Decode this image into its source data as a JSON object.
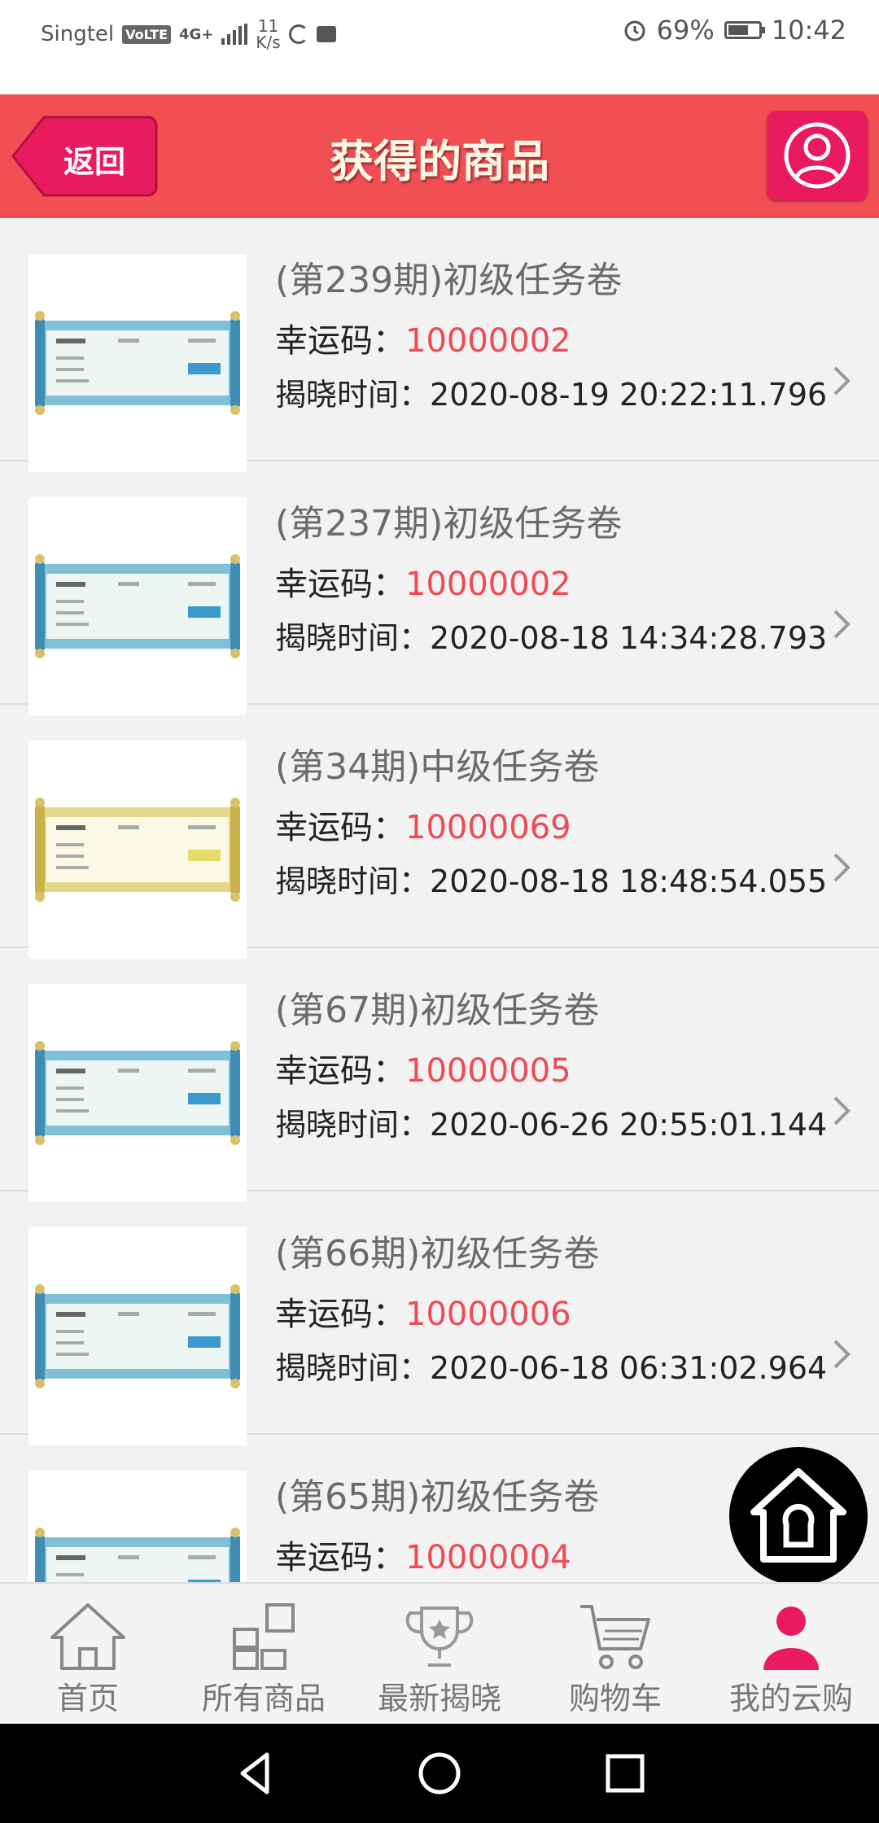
{
  "status_bar": {
    "carrier": "Singtel",
    "volte": "VoLTE",
    "network": "4G+",
    "speed_value": "11",
    "speed_unit": "K/s",
    "battery": "69%",
    "time": "10:42"
  },
  "header": {
    "back_label": "返回",
    "title": "获得的商品",
    "user_icon": "user-circle-icon"
  },
  "labels": {
    "lucky_code": "幸运码：",
    "reveal_time": "揭晓时间："
  },
  "items": [
    {
      "title": "(第239期)初级任务卷",
      "code": "10000002",
      "time": "2020-08-19 20:22:11.796",
      "scroll": "blue",
      "thumb_title": "初级卷轴",
      "thumb_btn": "兑换"
    },
    {
      "title": "(第237期)初级任务卷",
      "code": "10000002",
      "time": "2020-08-18 14:34:28.793",
      "scroll": "blue",
      "thumb_title": "初级卷轴",
      "thumb_btn": "兑换"
    },
    {
      "title": "(第34期)中级任务卷",
      "code": "10000069",
      "time": "2020-08-18 18:48:54.055",
      "scroll": "gold",
      "thumb_title": "中级卷轴",
      "thumb_btn": "兑换"
    },
    {
      "title": "(第67期)初级任务卷",
      "code": "10000005",
      "time": "2020-06-26 20:55:01.144",
      "scroll": "blue",
      "thumb_title": "初级卷轴",
      "thumb_btn": "兑换"
    },
    {
      "title": "(第66期)初级任务卷",
      "code": "10000006",
      "time": "2020-06-18 06:31:02.964",
      "scroll": "blue",
      "thumb_title": "初级卷轴",
      "thumb_btn": "兑换"
    },
    {
      "title": "(第65期)初级任务卷",
      "code": "10000004",
      "time": "",
      "scroll": "blue",
      "thumb_title": "初级卷轴",
      "thumb_btn": "兑换"
    }
  ],
  "tabs": [
    {
      "label": "首页",
      "icon": "home-icon"
    },
    {
      "label": "所有商品",
      "icon": "grid-icon"
    },
    {
      "label": "最新揭晓",
      "icon": "trophy-icon"
    },
    {
      "label": "购物车",
      "icon": "cart-icon"
    },
    {
      "label": "我的云购",
      "icon": "person-icon",
      "active": true
    }
  ],
  "colors": {
    "header_bg": "#f24f55",
    "accent_pink": "#ea1a5e",
    "code_red": "#ef4a55"
  }
}
